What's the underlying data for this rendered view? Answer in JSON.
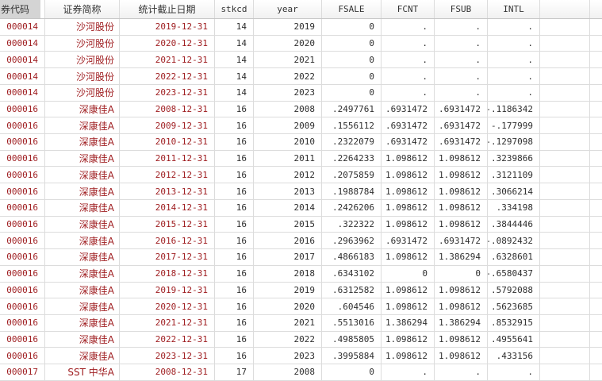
{
  "app": {
    "name": "data-editor-grid"
  },
  "colors": {
    "string_text": "#9e1b1e",
    "numeric_text": "#2e2e2e",
    "grid_line": "#dcdcdc",
    "selected_header_bg": "#d4d4d4"
  },
  "table": {
    "columns": [
      {
        "key": "code",
        "label": "券代码",
        "selected": true
      },
      {
        "key": "name",
        "label": "证券简称"
      },
      {
        "key": "date",
        "label": "统计截止日期"
      },
      {
        "key": "stkcd",
        "label": "stkcd"
      },
      {
        "key": "year",
        "label": "year"
      },
      {
        "key": "fsale",
        "label": "FSALE"
      },
      {
        "key": "fcnt",
        "label": "FCNT"
      },
      {
        "key": "fsub",
        "label": "FSUB"
      },
      {
        "key": "intl",
        "label": "INTL"
      },
      {
        "key": "blank1",
        "label": ""
      },
      {
        "key": "blank2",
        "label": ""
      }
    ],
    "rows": [
      {
        "code": "000014",
        "name": "沙河股份",
        "date": "2019-12-31",
        "stkcd": "14",
        "year": "2019",
        "fsale": "0",
        "fcnt": ".",
        "fsub": ".",
        "intl": "."
      },
      {
        "code": "000014",
        "name": "沙河股份",
        "date": "2020-12-31",
        "stkcd": "14",
        "year": "2020",
        "fsale": "0",
        "fcnt": ".",
        "fsub": ".",
        "intl": "."
      },
      {
        "code": "000014",
        "name": "沙河股份",
        "date": "2021-12-31",
        "stkcd": "14",
        "year": "2021",
        "fsale": "0",
        "fcnt": ".",
        "fsub": ".",
        "intl": "."
      },
      {
        "code": "000014",
        "name": "沙河股份",
        "date": "2022-12-31",
        "stkcd": "14",
        "year": "2022",
        "fsale": "0",
        "fcnt": ".",
        "fsub": ".",
        "intl": "."
      },
      {
        "code": "000014",
        "name": "沙河股份",
        "date": "2023-12-31",
        "stkcd": "14",
        "year": "2023",
        "fsale": "0",
        "fcnt": ".",
        "fsub": ".",
        "intl": "."
      },
      {
        "code": "000016",
        "name": "深康佳A",
        "date": "2008-12-31",
        "stkcd": "16",
        "year": "2008",
        "fsale": ".2497761",
        "fcnt": ".6931472",
        "fsub": ".6931472",
        "intl": "-.1186342"
      },
      {
        "code": "000016",
        "name": "深康佳A",
        "date": "2009-12-31",
        "stkcd": "16",
        "year": "2009",
        "fsale": ".1556112",
        "fcnt": ".6931472",
        "fsub": ".6931472",
        "intl": "-.177999"
      },
      {
        "code": "000016",
        "name": "深康佳A",
        "date": "2010-12-31",
        "stkcd": "16",
        "year": "2010",
        "fsale": ".2322079",
        "fcnt": ".6931472",
        "fsub": ".6931472",
        "intl": "-.1297098"
      },
      {
        "code": "000016",
        "name": "深康佳A",
        "date": "2011-12-31",
        "stkcd": "16",
        "year": "2011",
        "fsale": ".2264233",
        "fcnt": "1.098612",
        "fsub": "1.098612",
        "intl": ".3239866"
      },
      {
        "code": "000016",
        "name": "深康佳A",
        "date": "2012-12-31",
        "stkcd": "16",
        "year": "2012",
        "fsale": ".2075859",
        "fcnt": "1.098612",
        "fsub": "1.098612",
        "intl": ".3121109"
      },
      {
        "code": "000016",
        "name": "深康佳A",
        "date": "2013-12-31",
        "stkcd": "16",
        "year": "2013",
        "fsale": ".1988784",
        "fcnt": "1.098612",
        "fsub": "1.098612",
        "intl": ".3066214"
      },
      {
        "code": "000016",
        "name": "深康佳A",
        "date": "2014-12-31",
        "stkcd": "16",
        "year": "2014",
        "fsale": ".2426206",
        "fcnt": "1.098612",
        "fsub": "1.098612",
        "intl": ".334198"
      },
      {
        "code": "000016",
        "name": "深康佳A",
        "date": "2015-12-31",
        "stkcd": "16",
        "year": "2015",
        "fsale": ".322322",
        "fcnt": "1.098612",
        "fsub": "1.098612",
        "intl": ".3844446"
      },
      {
        "code": "000016",
        "name": "深康佳A",
        "date": "2016-12-31",
        "stkcd": "16",
        "year": "2016",
        "fsale": ".2963962",
        "fcnt": ".6931472",
        "fsub": ".6931472",
        "intl": "-.0892432"
      },
      {
        "code": "000016",
        "name": "深康佳A",
        "date": "2017-12-31",
        "stkcd": "16",
        "year": "2017",
        "fsale": ".4866183",
        "fcnt": "1.098612",
        "fsub": "1.386294",
        "intl": ".6328601"
      },
      {
        "code": "000016",
        "name": "深康佳A",
        "date": "2018-12-31",
        "stkcd": "16",
        "year": "2018",
        "fsale": ".6343102",
        "fcnt": "0",
        "fsub": "0",
        "intl": "-.6580437"
      },
      {
        "code": "000016",
        "name": "深康佳A",
        "date": "2019-12-31",
        "stkcd": "16",
        "year": "2019",
        "fsale": ".6312582",
        "fcnt": "1.098612",
        "fsub": "1.098612",
        "intl": ".5792088"
      },
      {
        "code": "000016",
        "name": "深康佳A",
        "date": "2020-12-31",
        "stkcd": "16",
        "year": "2020",
        "fsale": ".604546",
        "fcnt": "1.098612",
        "fsub": "1.098612",
        "intl": ".5623685"
      },
      {
        "code": "000016",
        "name": "深康佳A",
        "date": "2021-12-31",
        "stkcd": "16",
        "year": "2021",
        "fsale": ".5513016",
        "fcnt": "1.386294",
        "fsub": "1.386294",
        "intl": ".8532915"
      },
      {
        "code": "000016",
        "name": "深康佳A",
        "date": "2022-12-31",
        "stkcd": "16",
        "year": "2022",
        "fsale": ".4985805",
        "fcnt": "1.098612",
        "fsub": "1.098612",
        "intl": ".4955641"
      },
      {
        "code": "000016",
        "name": "深康佳A",
        "date": "2023-12-31",
        "stkcd": "16",
        "year": "2023",
        "fsale": ".3995884",
        "fcnt": "1.098612",
        "fsub": "1.098612",
        "intl": ".433156"
      },
      {
        "code": "000017",
        "name": "SST 中华A",
        "date": "2008-12-31",
        "stkcd": "17",
        "year": "2008",
        "fsale": "0",
        "fcnt": ".",
        "fsub": ".",
        "intl": "."
      }
    ]
  }
}
